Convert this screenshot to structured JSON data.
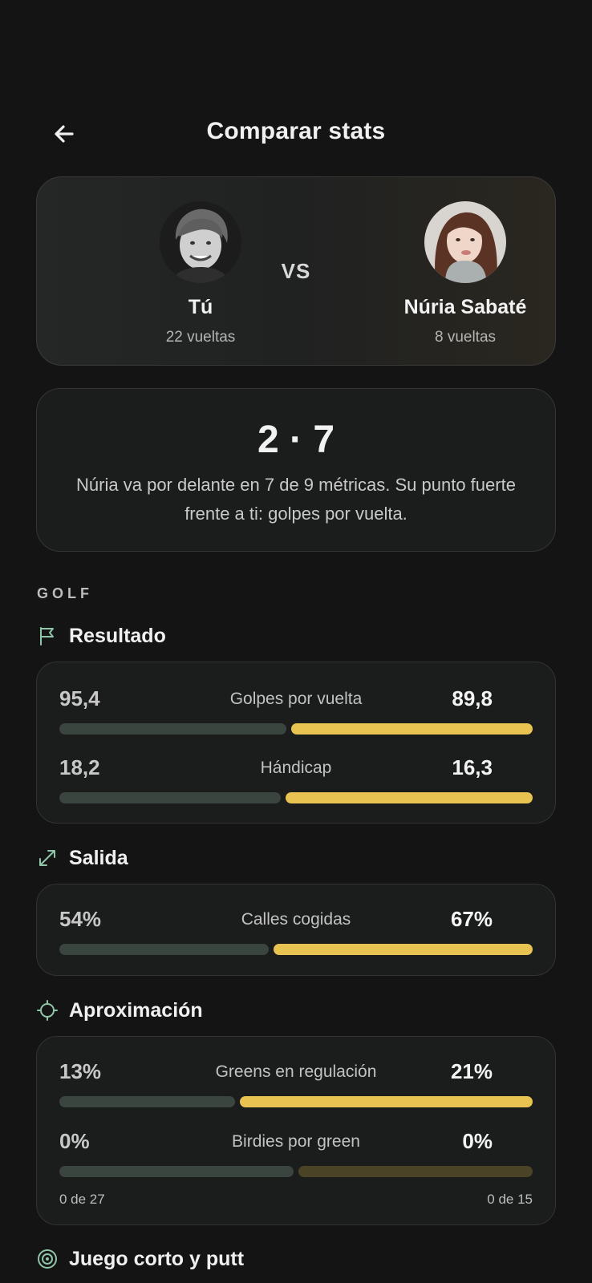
{
  "header": {
    "title": "Comparar stats",
    "back_icon": "arrow-left-icon"
  },
  "players": {
    "me": {
      "name": "Tú",
      "rounds": "22 vueltas"
    },
    "vs": "VS",
    "rival": {
      "name": "Núria Sabaté",
      "rounds": "8 vueltas"
    }
  },
  "summary": {
    "score": "2 · 7",
    "text": "Núria va por delante en 7 de 9 métricas. Su punto fuerte frente a ti: golpes por vuelta."
  },
  "section_label": "GOLF",
  "categories": {
    "resultado": {
      "title": "Resultado",
      "icon": "flag-icon"
    },
    "salida": {
      "title": "Salida",
      "icon": "expand-arrows-icon"
    },
    "aproximacion": {
      "title": "Aproximación",
      "icon": "crosshair-icon"
    },
    "juego_corto": {
      "title": "Juego corto y putt",
      "icon": "target-icon"
    }
  },
  "metrics": {
    "golpes": {
      "label": "Golpes por vuelta",
      "mine": "95,4",
      "theirs": "89,8",
      "mine_share": 0.485
    },
    "handicap": {
      "label": "Hándicap",
      "mine": "18,2",
      "theirs": "16,3",
      "mine_share": 0.472
    },
    "calles": {
      "label": "Calles cogidas",
      "mine": "54%",
      "theirs": "67%",
      "mine_share": 0.447
    },
    "greens": {
      "label": "Greens en regulación",
      "mine": "13%",
      "theirs": "21%",
      "mine_share": 0.375
    },
    "birdies": {
      "label": "Birdies por green",
      "mine": "0%",
      "theirs": "0%",
      "mine_share": 0.5,
      "foot_mine": "0 de 27",
      "foot_theirs": "0 de 15"
    }
  },
  "colors": {
    "accent": "#e8c351",
    "mine_bar": "#3b4540",
    "background": "#141414"
  }
}
